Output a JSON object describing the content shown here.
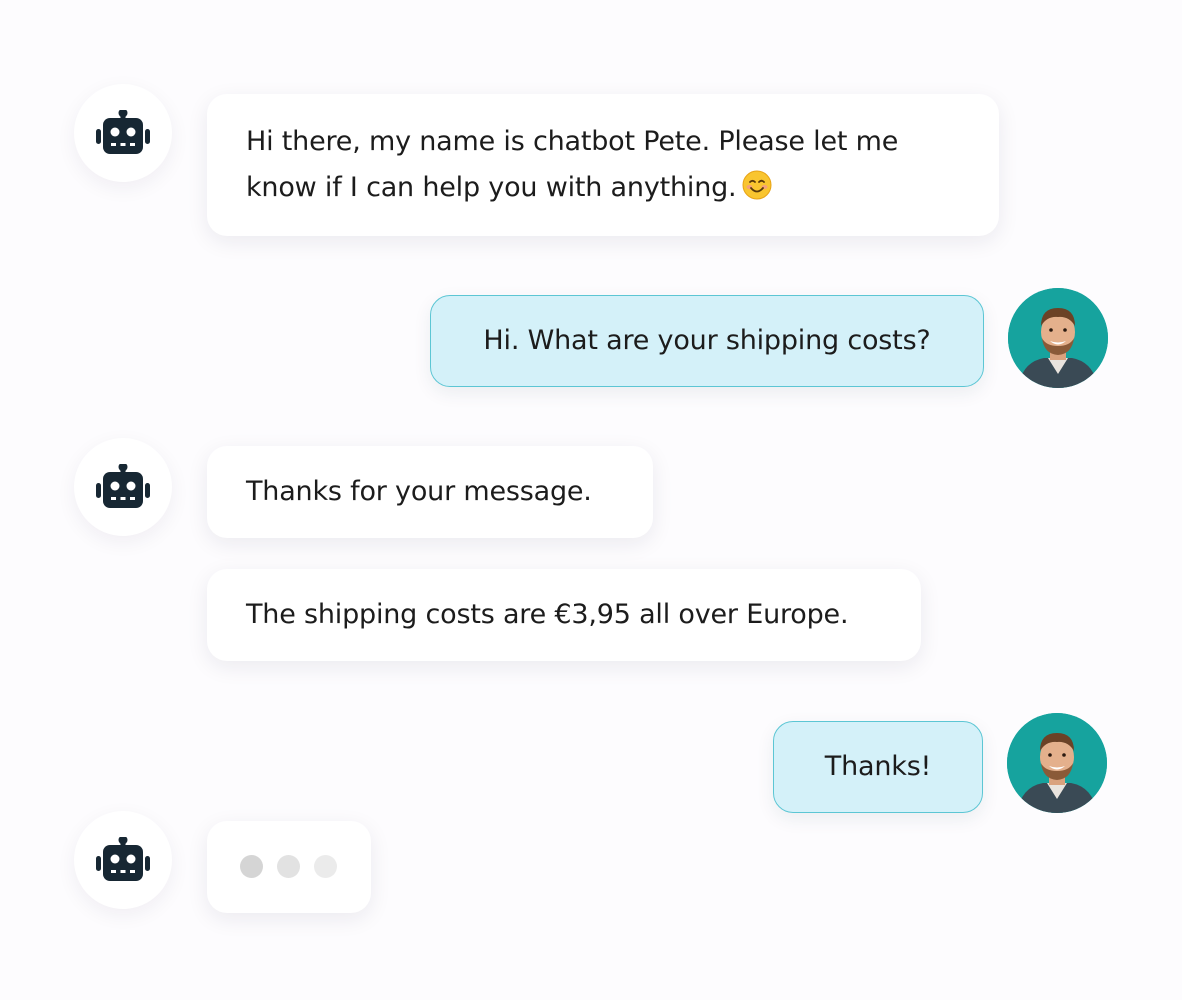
{
  "chat": {
    "messages": [
      {
        "sender": "bot",
        "text_line_1": "Hi there, my name is chatbot Pete. Please let me",
        "text_line_2": "know if I can help you with anything.",
        "emoji": "smiling-face-emoji"
      },
      {
        "sender": "user",
        "text": "Hi. What are your shipping costs?"
      },
      {
        "sender": "bot",
        "text": "Thanks for your message."
      },
      {
        "sender": "bot",
        "text": "The shipping costs are €3,95 all over Europe."
      },
      {
        "sender": "user",
        "text": "Thanks!"
      },
      {
        "sender": "bot",
        "typing": true
      }
    ],
    "bot_icon": "robot-icon",
    "user_avatar": "user-avatar-photo"
  },
  "colors": {
    "user_bubble_bg": "#d4f1f9",
    "user_bubble_border": "#5cc6d4",
    "bot_bubble_bg": "#ffffff",
    "avatar_bg": "#16a39e",
    "robot_icon": "#172733",
    "typing_dots": [
      "#d5d5d5",
      "#e2e2e2",
      "#ebebeb"
    ]
  }
}
